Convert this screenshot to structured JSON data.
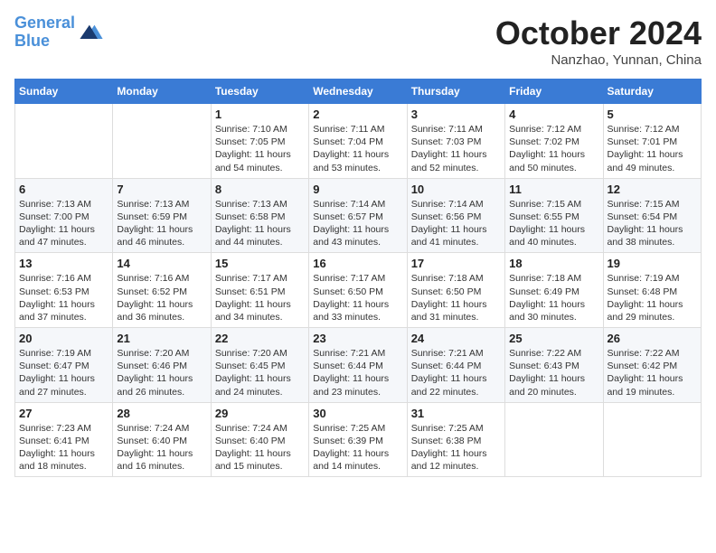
{
  "header": {
    "logo_line1": "General",
    "logo_line2": "Blue",
    "month": "October 2024",
    "location": "Nanzhao, Yunnan, China"
  },
  "weekdays": [
    "Sunday",
    "Monday",
    "Tuesday",
    "Wednesday",
    "Thursday",
    "Friday",
    "Saturday"
  ],
  "weeks": [
    [
      {
        "day": "",
        "info": ""
      },
      {
        "day": "",
        "info": ""
      },
      {
        "day": "1",
        "info": "Sunrise: 7:10 AM\nSunset: 7:05 PM\nDaylight: 11 hours and 54 minutes."
      },
      {
        "day": "2",
        "info": "Sunrise: 7:11 AM\nSunset: 7:04 PM\nDaylight: 11 hours and 53 minutes."
      },
      {
        "day": "3",
        "info": "Sunrise: 7:11 AM\nSunset: 7:03 PM\nDaylight: 11 hours and 52 minutes."
      },
      {
        "day": "4",
        "info": "Sunrise: 7:12 AM\nSunset: 7:02 PM\nDaylight: 11 hours and 50 minutes."
      },
      {
        "day": "5",
        "info": "Sunrise: 7:12 AM\nSunset: 7:01 PM\nDaylight: 11 hours and 49 minutes."
      }
    ],
    [
      {
        "day": "6",
        "info": "Sunrise: 7:13 AM\nSunset: 7:00 PM\nDaylight: 11 hours and 47 minutes."
      },
      {
        "day": "7",
        "info": "Sunrise: 7:13 AM\nSunset: 6:59 PM\nDaylight: 11 hours and 46 minutes."
      },
      {
        "day": "8",
        "info": "Sunrise: 7:13 AM\nSunset: 6:58 PM\nDaylight: 11 hours and 44 minutes."
      },
      {
        "day": "9",
        "info": "Sunrise: 7:14 AM\nSunset: 6:57 PM\nDaylight: 11 hours and 43 minutes."
      },
      {
        "day": "10",
        "info": "Sunrise: 7:14 AM\nSunset: 6:56 PM\nDaylight: 11 hours and 41 minutes."
      },
      {
        "day": "11",
        "info": "Sunrise: 7:15 AM\nSunset: 6:55 PM\nDaylight: 11 hours and 40 minutes."
      },
      {
        "day": "12",
        "info": "Sunrise: 7:15 AM\nSunset: 6:54 PM\nDaylight: 11 hours and 38 minutes."
      }
    ],
    [
      {
        "day": "13",
        "info": "Sunrise: 7:16 AM\nSunset: 6:53 PM\nDaylight: 11 hours and 37 minutes."
      },
      {
        "day": "14",
        "info": "Sunrise: 7:16 AM\nSunset: 6:52 PM\nDaylight: 11 hours and 36 minutes."
      },
      {
        "day": "15",
        "info": "Sunrise: 7:17 AM\nSunset: 6:51 PM\nDaylight: 11 hours and 34 minutes."
      },
      {
        "day": "16",
        "info": "Sunrise: 7:17 AM\nSunset: 6:50 PM\nDaylight: 11 hours and 33 minutes."
      },
      {
        "day": "17",
        "info": "Sunrise: 7:18 AM\nSunset: 6:50 PM\nDaylight: 11 hours and 31 minutes."
      },
      {
        "day": "18",
        "info": "Sunrise: 7:18 AM\nSunset: 6:49 PM\nDaylight: 11 hours and 30 minutes."
      },
      {
        "day": "19",
        "info": "Sunrise: 7:19 AM\nSunset: 6:48 PM\nDaylight: 11 hours and 29 minutes."
      }
    ],
    [
      {
        "day": "20",
        "info": "Sunrise: 7:19 AM\nSunset: 6:47 PM\nDaylight: 11 hours and 27 minutes."
      },
      {
        "day": "21",
        "info": "Sunrise: 7:20 AM\nSunset: 6:46 PM\nDaylight: 11 hours and 26 minutes."
      },
      {
        "day": "22",
        "info": "Sunrise: 7:20 AM\nSunset: 6:45 PM\nDaylight: 11 hours and 24 minutes."
      },
      {
        "day": "23",
        "info": "Sunrise: 7:21 AM\nSunset: 6:44 PM\nDaylight: 11 hours and 23 minutes."
      },
      {
        "day": "24",
        "info": "Sunrise: 7:21 AM\nSunset: 6:44 PM\nDaylight: 11 hours and 22 minutes."
      },
      {
        "day": "25",
        "info": "Sunrise: 7:22 AM\nSunset: 6:43 PM\nDaylight: 11 hours and 20 minutes."
      },
      {
        "day": "26",
        "info": "Sunrise: 7:22 AM\nSunset: 6:42 PM\nDaylight: 11 hours and 19 minutes."
      }
    ],
    [
      {
        "day": "27",
        "info": "Sunrise: 7:23 AM\nSunset: 6:41 PM\nDaylight: 11 hours and 18 minutes."
      },
      {
        "day": "28",
        "info": "Sunrise: 7:24 AM\nSunset: 6:40 PM\nDaylight: 11 hours and 16 minutes."
      },
      {
        "day": "29",
        "info": "Sunrise: 7:24 AM\nSunset: 6:40 PM\nDaylight: 11 hours and 15 minutes."
      },
      {
        "day": "30",
        "info": "Sunrise: 7:25 AM\nSunset: 6:39 PM\nDaylight: 11 hours and 14 minutes."
      },
      {
        "day": "31",
        "info": "Sunrise: 7:25 AM\nSunset: 6:38 PM\nDaylight: 11 hours and 12 minutes."
      },
      {
        "day": "",
        "info": ""
      },
      {
        "day": "",
        "info": ""
      }
    ]
  ]
}
